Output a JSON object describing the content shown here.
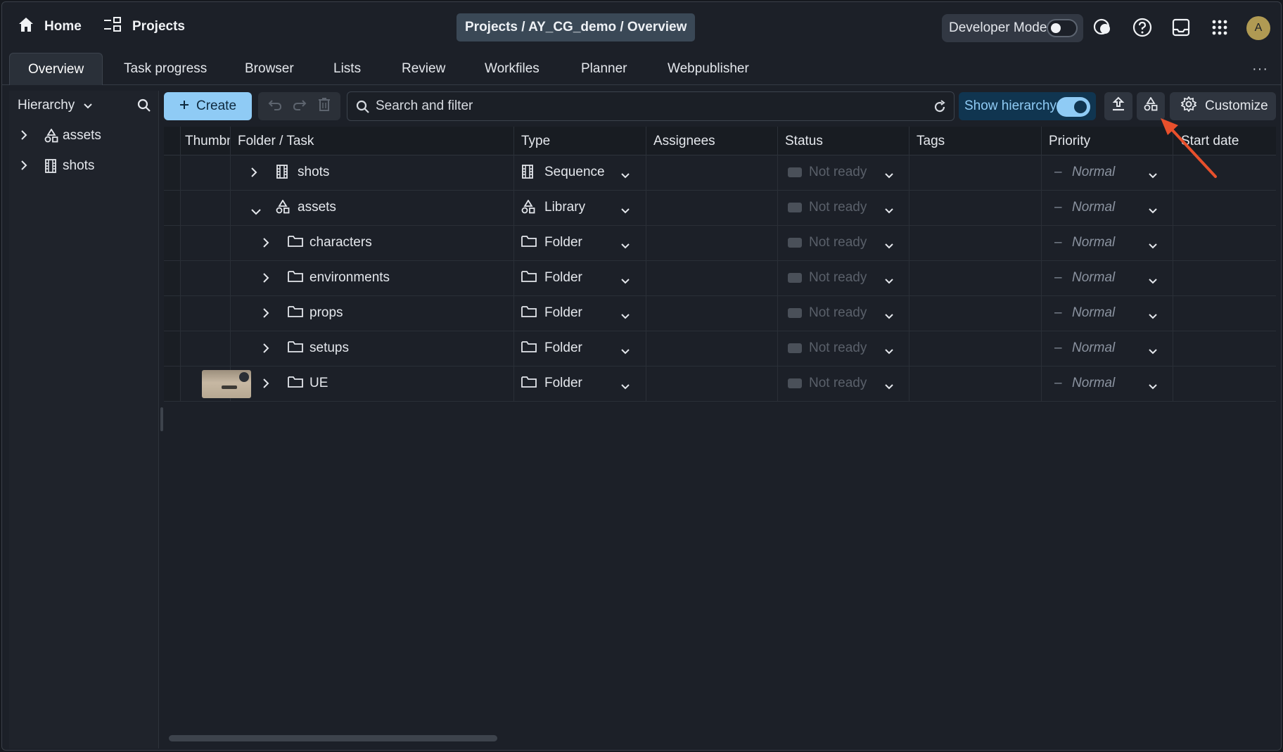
{
  "topbar": {
    "home_label": "Home",
    "projects_label": "Projects",
    "breadcrumb": "Projects / AY_CG_demo / Overview",
    "developer_mode_label": "Developer Mode",
    "developer_mode_on": false,
    "avatar_initial": "A"
  },
  "tabs": [
    {
      "label": "Overview",
      "active": true
    },
    {
      "label": "Task progress"
    },
    {
      "label": "Browser"
    },
    {
      "label": "Lists"
    },
    {
      "label": "Review"
    },
    {
      "label": "Workfiles"
    },
    {
      "label": "Planner"
    },
    {
      "label": "Webpublisher"
    }
  ],
  "tabs_more": "···",
  "sidebar": {
    "mode_label": "Hierarchy",
    "items": [
      {
        "label": "assets",
        "icon": "library-icon"
      },
      {
        "label": "shots",
        "icon": "film-icon"
      }
    ]
  },
  "toolbar": {
    "create_label": "Create",
    "search_placeholder": "Search and filter",
    "show_hierarchy_label": "Show hierarchy",
    "show_hierarchy_on": true,
    "customize_label": "Customize"
  },
  "table": {
    "headers": [
      "Thumbn",
      "Folder / Task",
      "Type",
      "Assignees",
      "Status",
      "Tags",
      "Priority",
      "Start date"
    ],
    "rows": [
      {
        "name": "shots",
        "type": "Sequence",
        "status": "Not ready",
        "priority": "Normal",
        "priority_dash": "–"
      },
      {
        "name": "assets",
        "type": "Library",
        "status": "Not ready",
        "priority": "Normal",
        "priority_dash": "–"
      },
      {
        "name": "characters",
        "type": "Folder",
        "status": "Not ready",
        "priority": "Normal",
        "priority_dash": "–"
      },
      {
        "name": "environments",
        "type": "Folder",
        "status": "Not ready",
        "priority": "Normal",
        "priority_dash": "–"
      },
      {
        "name": "props",
        "type": "Folder",
        "status": "Not ready",
        "priority": "Normal",
        "priority_dash": "–"
      },
      {
        "name": "setups",
        "type": "Folder",
        "status": "Not ready",
        "priority": "Normal",
        "priority_dash": "–"
      },
      {
        "name": "UE",
        "type": "Folder",
        "status": "Not ready",
        "priority": "Normal",
        "priority_dash": "–",
        "has_thumbnail": true
      }
    ]
  },
  "colors": {
    "accent": "#8fcbf5",
    "annotation_arrow": "#e8502c"
  }
}
